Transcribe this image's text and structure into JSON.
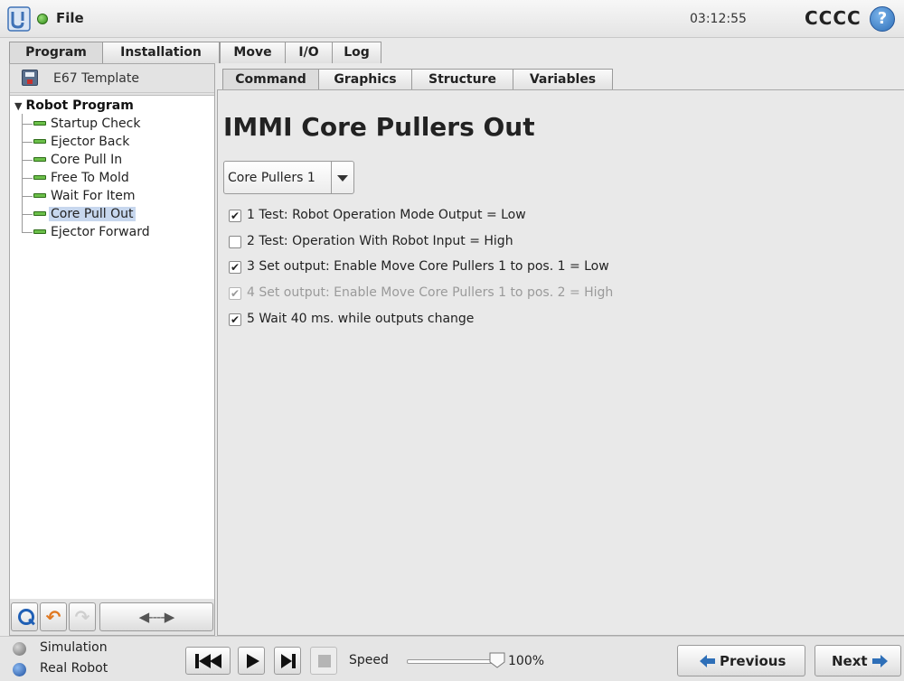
{
  "header": {
    "file_label": "File",
    "clock": "03:12:55",
    "robot_name": "CCCC",
    "help_glyph": "?",
    "status_color": "#3d9a1f"
  },
  "main_tabs": [
    {
      "label": "Program",
      "active": true
    },
    {
      "label": "Installation",
      "active": false
    },
    {
      "label": "Move",
      "active": false
    },
    {
      "label": "I/O",
      "active": false
    },
    {
      "label": "Log",
      "active": false
    }
  ],
  "program": {
    "name": "E67 Template",
    "tree_root": "Robot Program",
    "tree_items": [
      {
        "label": "Startup Check",
        "selected": false
      },
      {
        "label": "Ejector Back",
        "selected": false
      },
      {
        "label": "Core Pull In",
        "selected": false
      },
      {
        "label": "Free To Mold",
        "selected": false
      },
      {
        "label": "Wait For Item",
        "selected": false
      },
      {
        "label": "Core Pull Out",
        "selected": true
      },
      {
        "label": "Ejector Forward",
        "selected": false
      }
    ],
    "toolbar": {
      "search_icon": "search-icon",
      "undo_icon": "undo-arrow-icon",
      "redo_icon": "redo-arrow-icon",
      "move_glyph": "◀----▶"
    }
  },
  "sub_tabs": [
    {
      "label": "Command",
      "active": true
    },
    {
      "label": "Graphics",
      "active": false
    },
    {
      "label": "Structure",
      "active": false
    },
    {
      "label": "Variables",
      "active": false
    }
  ],
  "command": {
    "title": "IMMI Core Pullers Out",
    "dropdown_value": "Core Pullers 1",
    "checks": [
      {
        "label": "1 Test: Robot Operation Mode Output = Low",
        "checked": true,
        "enabled": true
      },
      {
        "label": "2 Test: Operation With Robot Input = High",
        "checked": false,
        "enabled": true
      },
      {
        "label": "3 Set output: Enable Move Core Pullers 1 to pos. 1 = Low",
        "checked": true,
        "enabled": true
      },
      {
        "label": "4 Set output: Enable Move Core Pullers 1 to pos. 2 = High",
        "checked": true,
        "enabled": false
      },
      {
        "label": "5 Wait 40 ms. while outputs change",
        "checked": true,
        "enabled": true
      }
    ]
  },
  "bottom": {
    "simulation_label": "Simulation",
    "real_robot_label": "Real Robot",
    "speed_label": "Speed",
    "speed_value": "100%",
    "speed_fraction": 1.0,
    "previous_label": "Previous",
    "next_label": "Next"
  }
}
